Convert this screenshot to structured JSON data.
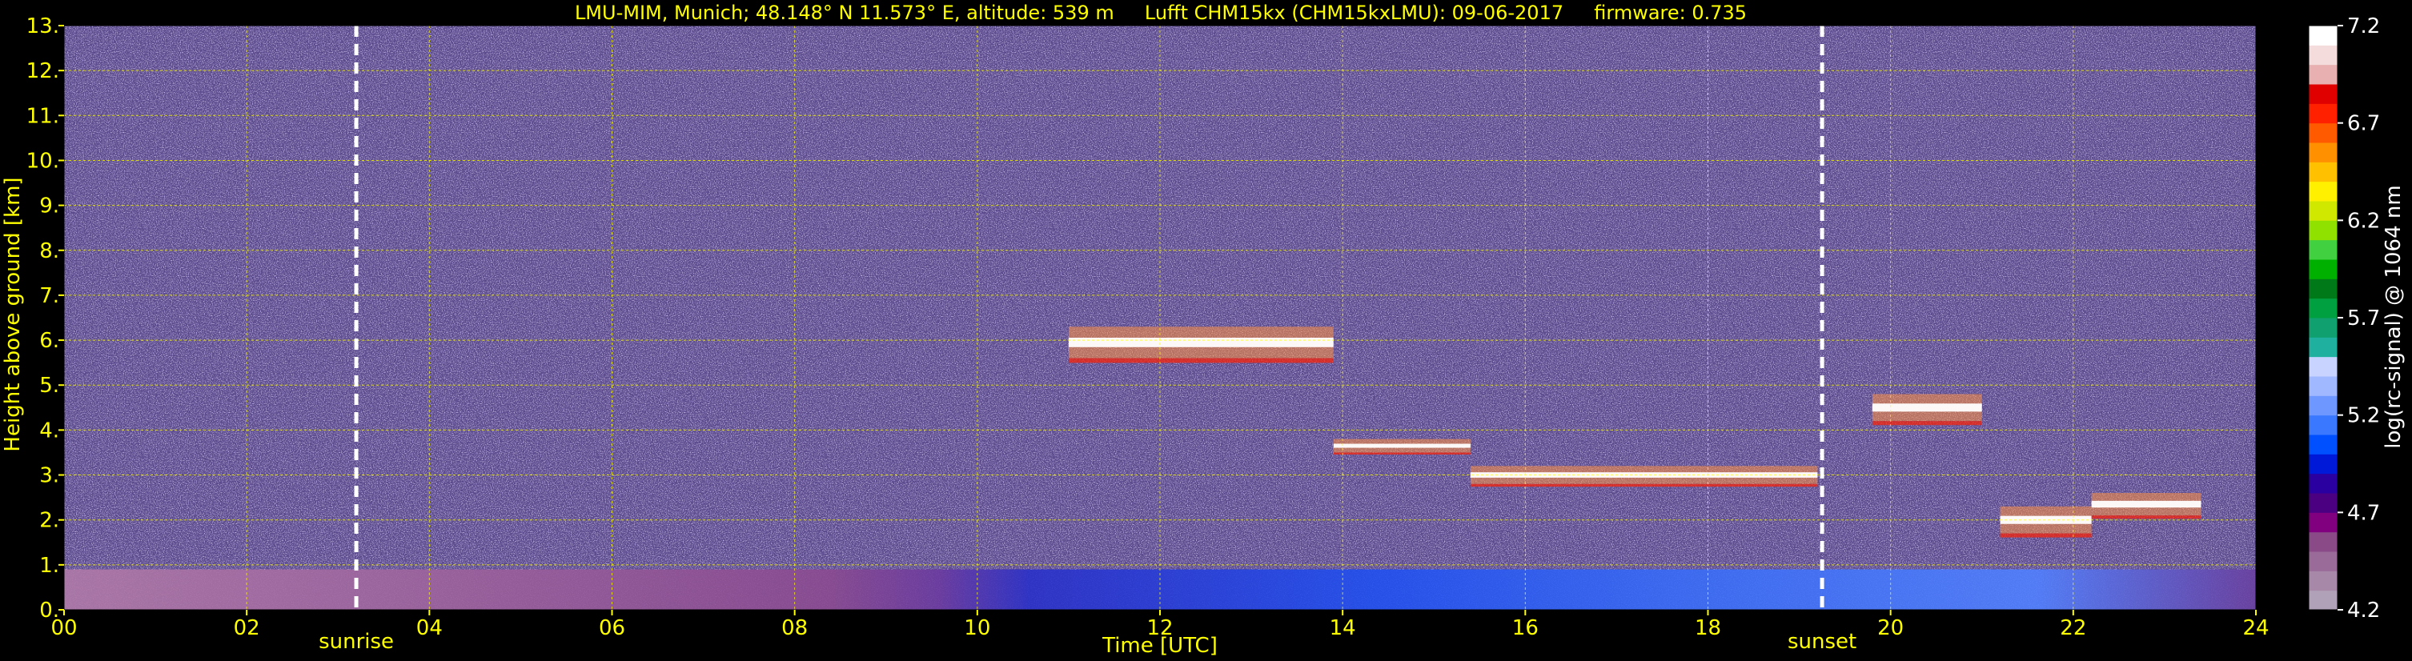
{
  "chart_data": {
    "type": "heatmap",
    "title": "LMU-MIM, Munich; 48.148° N 11.573° E, altitude: 539 m     Lufft CHM15kx (CHM15kxLMU): 09-06-2017     firmware: 0.735",
    "xlabel": "Time [UTC]",
    "ylabel": "Height above ground [km]",
    "xlim": [
      0,
      24
    ],
    "ylim": [
      0,
      13
    ],
    "x_ticks": [
      "00",
      "02",
      "04",
      "06",
      "08",
      "10",
      "12",
      "14",
      "16",
      "18",
      "20",
      "22",
      "24"
    ],
    "y_ticks": [
      "0.",
      "1.",
      "2.",
      "3.",
      "4.",
      "5.",
      "6.",
      "7.",
      "8.",
      "9.",
      "10.",
      "11.",
      "12.",
      "13."
    ],
    "grid": true,
    "events": [
      {
        "label": "sunrise",
        "time": 3.2
      },
      {
        "label": "sunset",
        "time": 19.25
      }
    ],
    "colorbar": {
      "label": "log(rc-signal) @ 1064 nm",
      "range": [
        4.2,
        7.2
      ],
      "ticks": [
        "4.2",
        "4.7",
        "5.2",
        "5.7",
        "6.2",
        "6.7",
        "7.2"
      ],
      "colors": [
        "#b0a0b8",
        "#a888a8",
        "#9a6a98",
        "#8a4a88",
        "#800080",
        "#4b0082",
        "#2a00a0",
        "#0018d8",
        "#0050ff",
        "#3a78ff",
        "#6e98ff",
        "#a0b8ff",
        "#c8d4ff",
        "#20b0a0",
        "#10a070",
        "#00a040",
        "#007a18",
        "#00b000",
        "#40d040",
        "#90e000",
        "#d0e800",
        "#fff000",
        "#ffc000",
        "#ff9000",
        "#ff5a00",
        "#ff2000",
        "#e00000",
        "#e8b0b0",
        "#f4dcdc",
        "#ffffff"
      ]
    },
    "features": [
      {
        "description": "aerosol boundary layer",
        "start": 0,
        "end": 24,
        "base": 0,
        "top": 0.9
      },
      {
        "description": "cloud layer",
        "start": 11.0,
        "end": 13.9,
        "base": 5.6,
        "top": 6.3
      },
      {
        "description": "cloud layer",
        "start": 13.9,
        "end": 15.4,
        "base": 3.5,
        "top": 3.8
      },
      {
        "description": "cloud layer",
        "start": 15.4,
        "end": 19.2,
        "base": 2.8,
        "top": 3.2
      },
      {
        "description": "cloud layer",
        "start": 19.8,
        "end": 21.0,
        "base": 4.2,
        "top": 4.8
      },
      {
        "description": "cloud layer",
        "start": 21.2,
        "end": 22.2,
        "base": 1.7,
        "top": 2.3
      },
      {
        "description": "cloud layer",
        "start": 22.2,
        "end": 23.4,
        "base": 2.1,
        "top": 2.6
      }
    ]
  }
}
